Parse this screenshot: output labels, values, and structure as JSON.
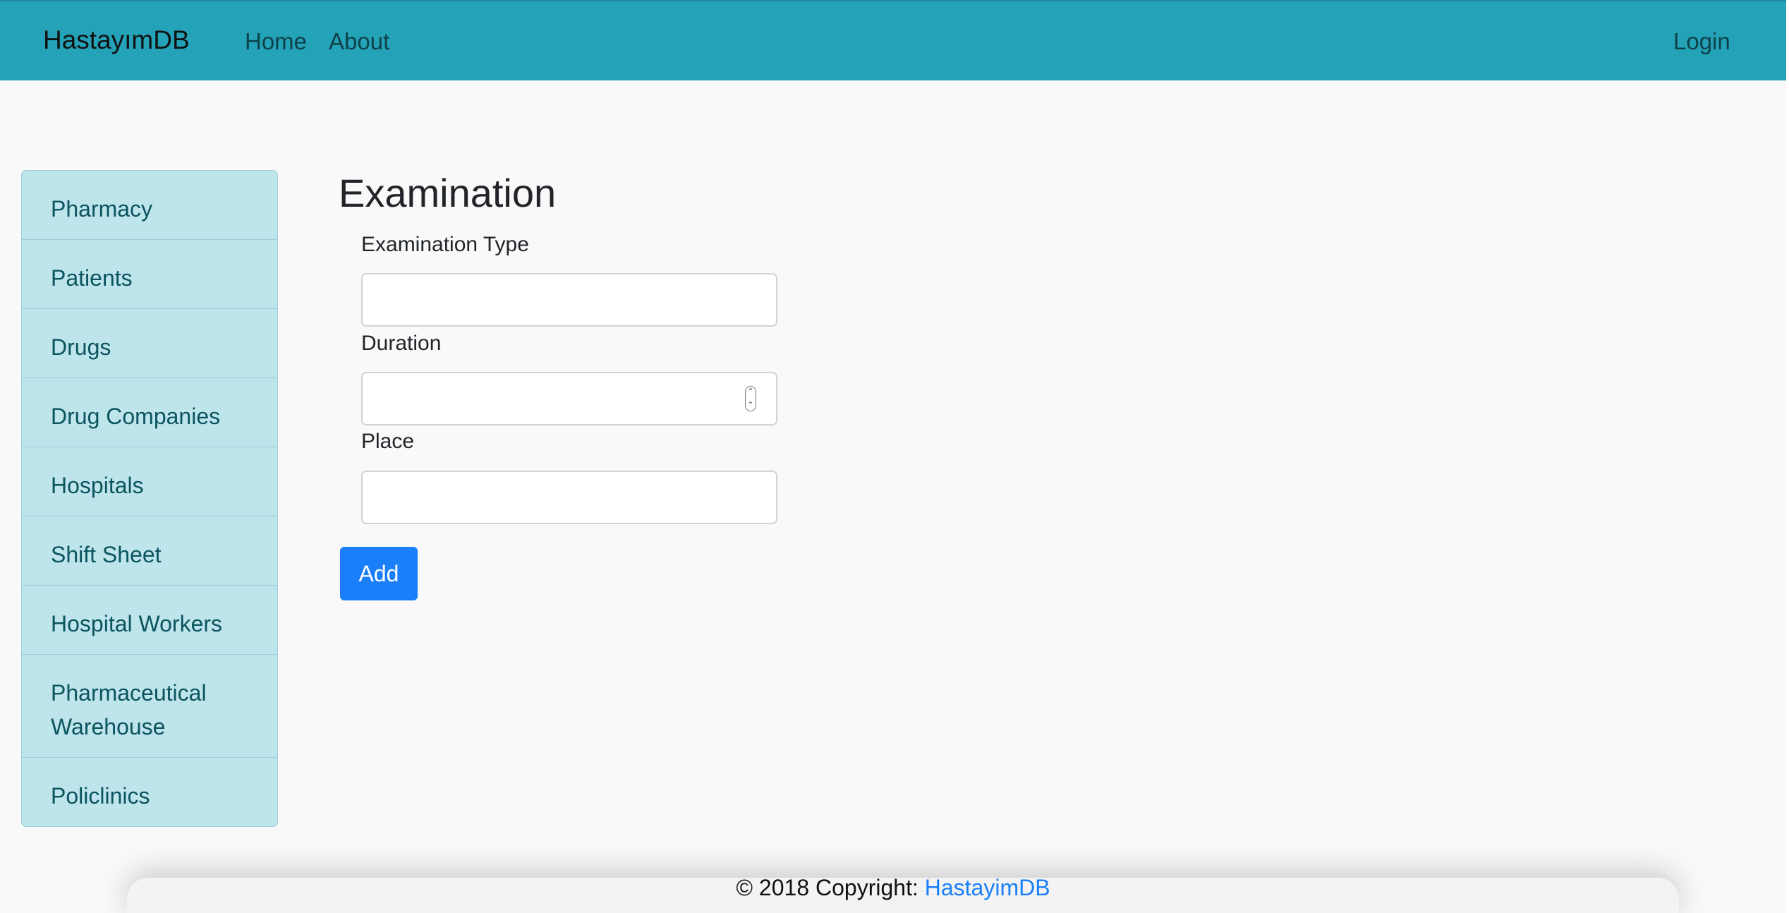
{
  "navbar": {
    "brand": "HastayımDB",
    "links": [
      "Home",
      "About"
    ],
    "login": "Login"
  },
  "sidebar": {
    "items": [
      {
        "label": "Pharmacy"
      },
      {
        "label": "Patients"
      },
      {
        "label": "Drugs"
      },
      {
        "label": "Drug Companies"
      },
      {
        "label": "Hospitals"
      },
      {
        "label": "Shift Sheet"
      },
      {
        "label": "Hospital Workers"
      },
      {
        "label": "Pharmaceutical Warehouse"
      },
      {
        "label": "Policlinics"
      }
    ]
  },
  "form": {
    "title": "Examination",
    "fields": [
      {
        "label": "Examination Type",
        "value": ""
      },
      {
        "label": "Duration",
        "value": ""
      },
      {
        "label": "Place",
        "value": ""
      }
    ],
    "submit_label": "Add"
  },
  "footer": {
    "text": "© 2018 Copyright: ",
    "link": "HastayimDB"
  },
  "colors": {
    "navbar": "#23a2b8",
    "sidebar_bg": "#bee5eb",
    "sidebar_text": "#0c5460",
    "primary": "#1a7ff8"
  }
}
